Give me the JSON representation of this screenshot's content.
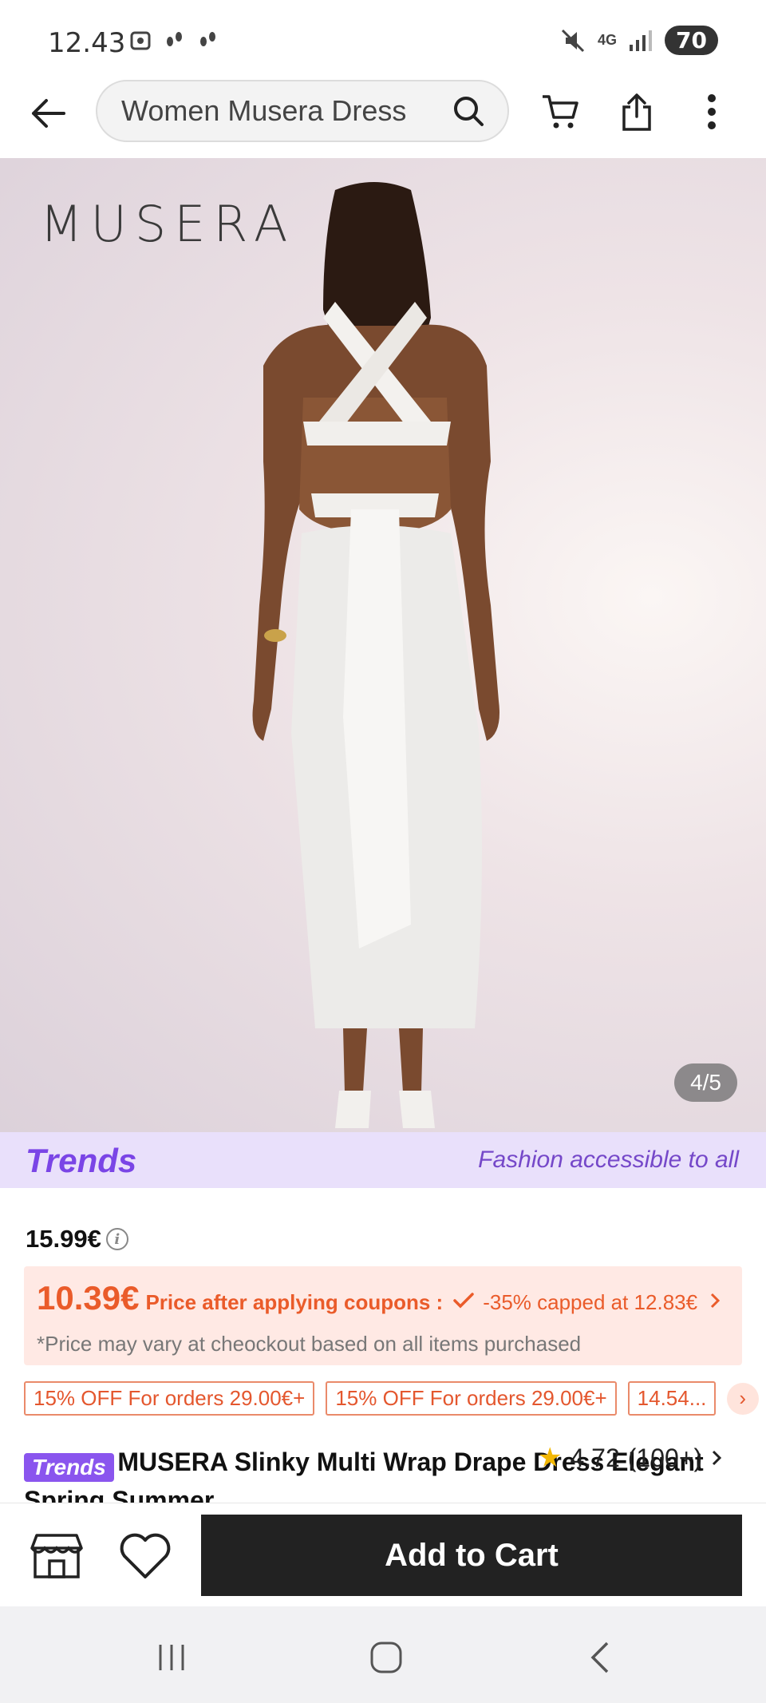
{
  "status_bar": {
    "time": "12.43",
    "network": "4G",
    "battery": "70"
  },
  "top_nav": {
    "search_text": "Women Musera Dress"
  },
  "hero": {
    "brand_logo": "MUSERA",
    "image_counter": "4/5"
  },
  "trends_banner": {
    "logo": "Trends",
    "tagline": "Fashion accessible to all"
  },
  "pricing": {
    "original_price": "15.99€",
    "final_price": "10.39€",
    "after_coupons_label": "Price after applying coupons :",
    "coupon_cap": "-35% capped at 12.83€",
    "note": "*Price may vary at cheockout based on all items purchased"
  },
  "coupons": [
    "15% OFF For orders 29.00€+",
    "15% OFF For orders 29.00€+",
    "14.54..."
  ],
  "product": {
    "badge": "Trends",
    "title": "MUSERA Slinky Multi Wrap Drape Dress Elegant Spring Summer",
    "rating": "4.72",
    "review_count": "(100+)"
  },
  "actions": {
    "add_to_cart": "Add to Cart"
  },
  "colors": {
    "accent_orange": "#ea5b2a",
    "trends_purple": "#7a45e6",
    "cta_dark": "#222222"
  }
}
